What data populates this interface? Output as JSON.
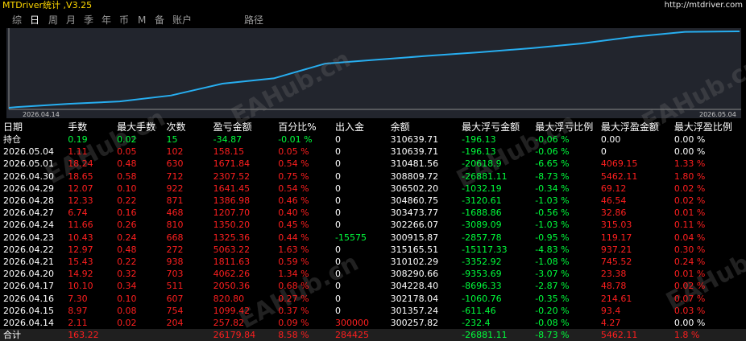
{
  "header": {
    "title": "MTDriver统计 ,V3.25",
    "url": "http://mtdriver.com"
  },
  "tabs": [
    {
      "label": "综",
      "active": false
    },
    {
      "label": "日",
      "active": true
    },
    {
      "label": "周",
      "active": false
    },
    {
      "label": "月",
      "active": false
    },
    {
      "label": "季",
      "active": false
    },
    {
      "label": "年",
      "active": false
    },
    {
      "label": "币",
      "active": false
    },
    {
      "label": "M",
      "active": false
    },
    {
      "label": "备",
      "active": false
    },
    {
      "label": "账户",
      "active": false
    },
    {
      "label": "路径",
      "active": false
    }
  ],
  "watermark": "EAHub.cn",
  "colors": {
    "profit": "#ff1f1f",
    "loss": "#00ff3c",
    "curve": "#27aef0",
    "panel": "#22252d",
    "text": "#ffffff"
  },
  "chart_data": {
    "type": "line",
    "x_start_label": "2026.04.14",
    "x_end_label": "2026.05.04",
    "x": [
      "2026.04.14",
      "2026.04.15",
      "2026.04.16",
      "2026.04.17",
      "2026.04.20",
      "2026.04.21",
      "2026.04.22",
      "2026.04.23",
      "2026.04.24",
      "2026.04.27",
      "2026.04.28",
      "2026.04.29",
      "2026.04.30",
      "2026.05.01",
      "2026.05.04"
    ],
    "y": [
      300257.82,
      301357.24,
      302178.04,
      304228.4,
      308290.66,
      310102.29,
      315165.51,
      300915.87,
      302266.07,
      303473.77,
      304860.75,
      306502.2,
      308809.72,
      310481.56,
      310639.71
    ],
    "series_values": [
      257.82,
      1357.24,
      2178.04,
      4228.4,
      8290.66,
      10102.29,
      15165.51,
      16491.14,
      17841.34,
      19049.04,
      20436.02,
      22077.47,
      24384.99,
      26056.83,
      26214.98
    ],
    "ylim": [
      0,
      26500
    ]
  },
  "table": {
    "headers": [
      "日期",
      "手数",
      "最大手数",
      "次数",
      "盈亏金额",
      "百分比%",
      "出入金",
      "余额",
      "最大浮亏金额",
      "最大浮亏比例",
      "最大浮盈金额",
      "最大浮盈比例"
    ],
    "holding": {
      "label": "持仓",
      "lots": "0.19",
      "max_lots": "0.02",
      "count": "15",
      "pl": "-34.87",
      "pct": "-0.01 %",
      "io": "0",
      "balance": "310639.71",
      "mfl": "-196.13",
      "mfr": "-0.06 %",
      "mpa": "0.00",
      "mpr": "0.00 %"
    },
    "rows": [
      [
        "2026.05.04",
        "1.11",
        "0.05",
        "102",
        "158.15",
        "0.05 %",
        "0",
        "310639.71",
        "-196.13",
        "-0.06 %",
        "0",
        "0.00 %"
      ],
      [
        "2026.05.01",
        "18.24",
        "0.48",
        "630",
        "1671.84",
        "0.54 %",
        "0",
        "310481.56",
        "-20618.9",
        "-6.65 %",
        "4069.15",
        "1.33 %"
      ],
      [
        "2026.04.30",
        "18.65",
        "0.58",
        "712",
        "2307.52",
        "0.75 %",
        "0",
        "308809.72",
        "-26881.11",
        "-8.73 %",
        "5462.11",
        "1.80 %"
      ],
      [
        "2026.04.29",
        "12.07",
        "0.10",
        "922",
        "1641.45",
        "0.54 %",
        "0",
        "306502.20",
        "-1032.19",
        "-0.34 %",
        "69.12",
        "0.02 %"
      ],
      [
        "2026.04.28",
        "12.33",
        "0.22",
        "871",
        "1386.98",
        "0.46 %",
        "0",
        "304860.75",
        "-3120.61",
        "-1.03 %",
        "46.54",
        "0.02 %"
      ],
      [
        "2026.04.27",
        "6.74",
        "0.16",
        "468",
        "1207.70",
        "0.40 %",
        "0",
        "303473.77",
        "-1688.86",
        "-0.56 %",
        "32.86",
        "0.01 %"
      ],
      [
        "2026.04.24",
        "11.66",
        "0.26",
        "810",
        "1350.20",
        "0.45 %",
        "0",
        "302266.07",
        "-3089.09",
        "-1.03 %",
        "315.03",
        "0.11 %"
      ],
      [
        "2026.04.23",
        "10.43",
        "0.24",
        "668",
        "1325.36",
        "0.44 %",
        "-15575",
        "300915.87",
        "-2857.78",
        "-0.95 %",
        "119.17",
        "0.04 %"
      ],
      [
        "2026.04.22",
        "12.97",
        "0.48",
        "272",
        "5063.22",
        "1.63 %",
        "0",
        "315165.51",
        "-15117.33",
        "-4.83 %",
        "937.21",
        "0.30 %"
      ],
      [
        "2026.04.21",
        "15.43",
        "0.22",
        "938",
        "1811.63",
        "0.59 %",
        "0",
        "310102.29",
        "-3352.92",
        "-1.08 %",
        "745.52",
        "0.24 %"
      ],
      [
        "2026.04.20",
        "14.92",
        "0.32",
        "703",
        "4062.26",
        "1.34 %",
        "0",
        "308290.66",
        "-9353.69",
        "-3.07 %",
        "23.38",
        "0.01 %"
      ],
      [
        "2026.04.17",
        "10.10",
        "0.34",
        "511",
        "2050.36",
        "0.68 %",
        "0",
        "304228.40",
        "-8696.33",
        "-2.87 %",
        "48.78",
        "0.02 %"
      ],
      [
        "2026.04.16",
        "7.30",
        "0.10",
        "607",
        "820.80",
        "0.27 %",
        "0",
        "302178.04",
        "-1060.76",
        "-0.35 %",
        "214.61",
        "0.07 %"
      ],
      [
        "2026.04.15",
        "8.97",
        "0.08",
        "754",
        "1099.42",
        "0.37 %",
        "0",
        "301357.24",
        "-611.46",
        "-0.20 %",
        "93.4",
        "0.03 %"
      ],
      [
        "2026.04.14",
        "2.11",
        "0.02",
        "204",
        "257.82",
        "0.09 %",
        "300000",
        "300257.82",
        "-232.4",
        "-0.08 %",
        "4.27",
        "0.00 %"
      ]
    ],
    "total": {
      "label": "合计",
      "lots": "163.22",
      "max_lots": "",
      "count": "",
      "pl": "26179.84",
      "pct": "8.58 %",
      "io": "284425",
      "balance": "",
      "mfl": "-26881.11",
      "mfr": "-8.73 %",
      "mpa": "5462.11",
      "mpr": "1.8 %"
    }
  }
}
